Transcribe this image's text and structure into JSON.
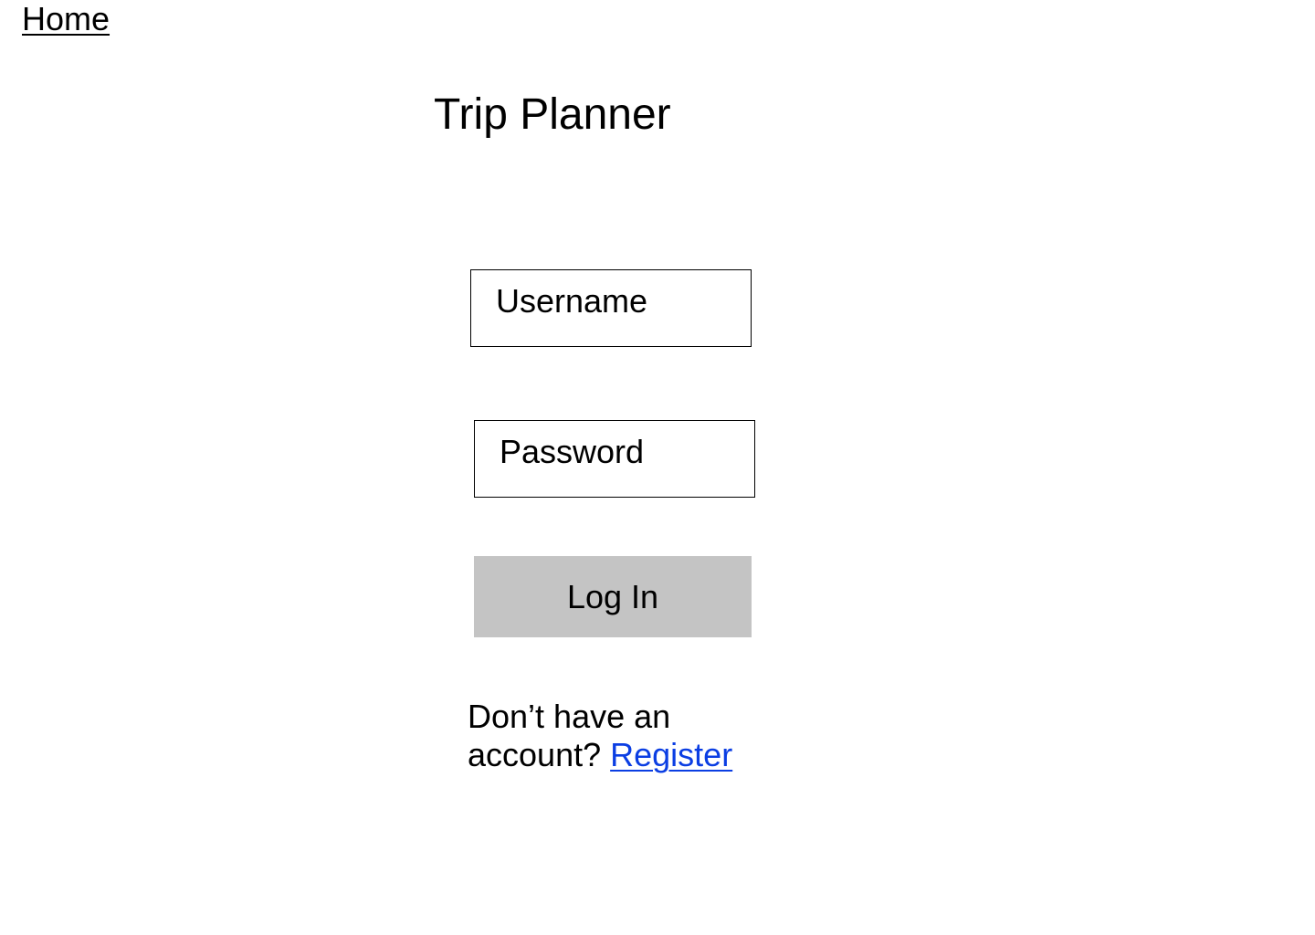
{
  "nav": {
    "home_label": "Home"
  },
  "header": {
    "title": "Trip Planner"
  },
  "form": {
    "username_placeholder": "Username",
    "password_placeholder": "Password",
    "login_label": "Log In"
  },
  "footer": {
    "prompt_line1": "Don’t have an",
    "prompt_line2": "account?",
    "register_label": "Register"
  },
  "colors": {
    "link": "#0b3ee3",
    "button_bg": "#c4c4c4",
    "text": "#000000",
    "background": "#ffffff"
  }
}
